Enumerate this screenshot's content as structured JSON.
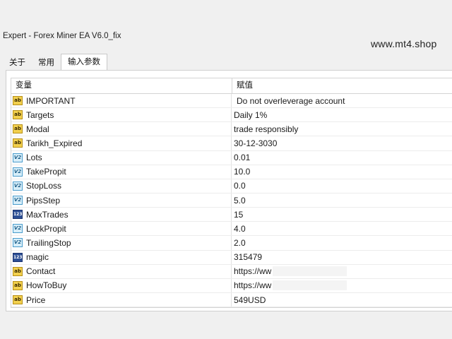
{
  "window": {
    "title": "Expert - Forex Miner EA V6.0_fix",
    "watermark": "www.mt4.shop"
  },
  "tabs": [
    {
      "label": "关于"
    },
    {
      "label": "常用"
    },
    {
      "label": "输入参数",
      "active": true
    }
  ],
  "table": {
    "headers": {
      "variable": "变量",
      "value": "赋值"
    },
    "rows": [
      {
        "icon": "ab",
        "name": "IMPORTANT",
        "value": "Do not overleverage account"
      },
      {
        "icon": "ab",
        "name": "Targets",
        "value": "Daily 1%"
      },
      {
        "icon": "ab",
        "name": "Modal",
        "value": "trade responsibly"
      },
      {
        "icon": "ab",
        "name": "Tarikh_Expired",
        "value": "30-12-3030"
      },
      {
        "icon": "v2",
        "name": "Lots",
        "value": "0.01"
      },
      {
        "icon": "v2",
        "name": "TakePropit",
        "value": "10.0"
      },
      {
        "icon": "v2",
        "name": "StopLoss",
        "value": "0.0"
      },
      {
        "icon": "v2",
        "name": "PipsStep",
        "value": "5.0"
      },
      {
        "icon": "123",
        "name": "MaxTrades",
        "value": "15"
      },
      {
        "icon": "v2",
        "name": "LockPropit",
        "value": "4.0"
      },
      {
        "icon": "v2",
        "name": "TrailingStop",
        "value": "2.0"
      },
      {
        "icon": "123",
        "name": "magic",
        "value": "315479"
      },
      {
        "icon": "ab",
        "name": "Contact",
        "value": "https://ww"
      },
      {
        "icon": "ab",
        "name": "HowToBuy",
        "value": "https://ww"
      },
      {
        "icon": "ab",
        "name": "Price",
        "value": "549USD"
      }
    ]
  },
  "icon_labels": {
    "ab": "ab",
    "v2": "V2",
    "123": "123"
  },
  "colors": {
    "string_icon": "#f2d04e",
    "double_icon": "#d7eef9",
    "int_icon": "#2c4f95"
  }
}
